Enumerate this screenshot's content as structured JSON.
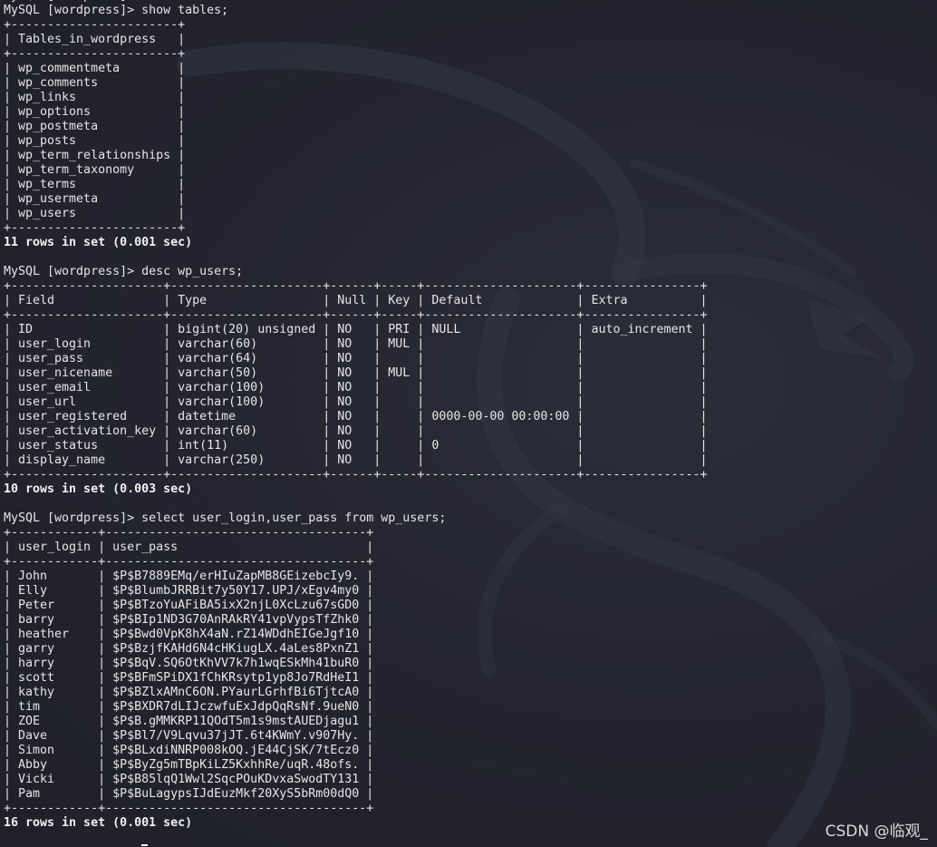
{
  "terminal": {
    "lines": [
      {
        "text": "MySQL [wordpress]>",
        "bold": false
      },
      {
        "text": "MySQL [wordpress]> show tables;",
        "bold": false
      },
      {
        "text": "+-----------------------+",
        "bold": false
      },
      {
        "text": "| Tables_in_wordpress   |",
        "bold": false
      },
      {
        "text": "+-----------------------+",
        "bold": false
      },
      {
        "text": "| wp_commentmeta        |",
        "bold": false
      },
      {
        "text": "| wp_comments           |",
        "bold": false
      },
      {
        "text": "| wp_links              |",
        "bold": false
      },
      {
        "text": "| wp_options            |",
        "bold": false
      },
      {
        "text": "| wp_postmeta           |",
        "bold": false
      },
      {
        "text": "| wp_posts              |",
        "bold": false
      },
      {
        "text": "| wp_term_relationships |",
        "bold": false
      },
      {
        "text": "| wp_term_taxonomy      |",
        "bold": false
      },
      {
        "text": "| wp_terms              |",
        "bold": false
      },
      {
        "text": "| wp_usermeta           |",
        "bold": false
      },
      {
        "text": "| wp_users              |",
        "bold": false
      },
      {
        "text": "+-----------------------+",
        "bold": false
      },
      {
        "text": "11 rows in set (0.001 sec)",
        "bold": true
      },
      {
        "text": "",
        "bold": false
      },
      {
        "text": "MySQL [wordpress]> desc wp_users;",
        "bold": false
      },
      {
        "text": "+---------------------+---------------------+------+-----+---------------------+----------------+",
        "bold": false
      },
      {
        "text": "| Field               | Type                | Null | Key | Default             | Extra          |",
        "bold": false
      },
      {
        "text": "+---------------------+---------------------+------+-----+---------------------+----------------+",
        "bold": false
      },
      {
        "text": "| ID                  | bigint(20) unsigned | NO   | PRI | NULL                | auto_increment |",
        "bold": false
      },
      {
        "text": "| user_login          | varchar(60)         | NO   | MUL |                     |                |",
        "bold": false
      },
      {
        "text": "| user_pass           | varchar(64)         | NO   |     |                     |                |",
        "bold": false
      },
      {
        "text": "| user_nicename       | varchar(50)         | NO   | MUL |                     |                |",
        "bold": false
      },
      {
        "text": "| user_email          | varchar(100)        | NO   |     |                     |                |",
        "bold": false
      },
      {
        "text": "| user_url            | varchar(100)        | NO   |     |                     |                |",
        "bold": false
      },
      {
        "text": "| user_registered     | datetime            | NO   |     | 0000-00-00 00:00:00 |                |",
        "bold": false
      },
      {
        "text": "| user_activation_key | varchar(60)         | NO   |     |                     |                |",
        "bold": false
      },
      {
        "text": "| user_status         | int(11)             | NO   |     | 0                   |                |",
        "bold": false
      },
      {
        "text": "| display_name        | varchar(250)        | NO   |     |                     |                |",
        "bold": false
      },
      {
        "text": "+---------------------+---------------------+------+-----+---------------------+----------------+",
        "bold": false
      },
      {
        "text": "10 rows in set (0.003 sec)",
        "bold": true
      },
      {
        "text": "",
        "bold": false
      },
      {
        "text": "MySQL [wordpress]> select user_login,user_pass from wp_users;",
        "bold": false
      },
      {
        "text": "+------------+------------------------------------+",
        "bold": false
      },
      {
        "text": "| user_login | user_pass                          |",
        "bold": false
      },
      {
        "text": "+------------+------------------------------------+",
        "bold": false
      },
      {
        "text": "| John       | $P$B7889EMq/erHIuZapMB8GEizebcIy9. |",
        "bold": false
      },
      {
        "text": "| Elly       | $P$BlumbJRRBit7y50Y17.UPJ/xEgv4my0 |",
        "bold": false
      },
      {
        "text": "| Peter      | $P$BTzoYuAFiBA5ixX2njL0XcLzu67sGD0 |",
        "bold": false
      },
      {
        "text": "| barry      | $P$BIp1ND3G70AnRAkRY41vpVypsTfZhk0 |",
        "bold": false
      },
      {
        "text": "| heather    | $P$Bwd0VpK8hX4aN.rZ14WDdhEIGeJgf10 |",
        "bold": false
      },
      {
        "text": "| garry      | $P$BzjfKAHd6N4cHKiugLX.4aLes8PxnZ1 |",
        "bold": false
      },
      {
        "text": "| harry      | $P$BqV.SQ6OtKhVV7k7h1wqESkMh41buR0 |",
        "bold": false
      },
      {
        "text": "| scott      | $P$BFmSPiDX1fChKRsytp1yp8Jo7RdHeI1 |",
        "bold": false
      },
      {
        "text": "| kathy      | $P$BZlxAMnC6ON.PYaurLGrhfBi6TjtcA0 |",
        "bold": false
      },
      {
        "text": "| tim        | $P$BXDR7dLIJczwfuExJdpQqRsNf.9ueN0 |",
        "bold": false
      },
      {
        "text": "| ZOE        | $P$B.gMMKRP11QOdT5m1s9mstAUEDjagu1 |",
        "bold": false
      },
      {
        "text": "| Dave       | $P$Bl7/V9Lqvu37jJT.6t4KWmY.v907Hy. |",
        "bold": false
      },
      {
        "text": "| Simon      | $P$BLxdiNNRP008kOQ.jE44CjSK/7tEcz0 |",
        "bold": false
      },
      {
        "text": "| Abby       | $P$ByZg5mTBpKiLZ5KxhhRe/uqR.48ofs. |",
        "bold": false
      },
      {
        "text": "| Vicki      | $P$B85lqQ1Wwl2SqcPOuKDvxaSwodTY131 |",
        "bold": false
      },
      {
        "text": "| Pam        | $P$BuLagypsIJdEuzMkf20XyS5bRm00dQ0 |",
        "bold": false
      },
      {
        "text": "+------------+------------------------------------+",
        "bold": false
      },
      {
        "text": "16 rows in set (0.001 sec)",
        "bold": true
      }
    ]
  },
  "watermark": {
    "text": "CSDN @临观_"
  },
  "colors": {
    "background": "#23242f",
    "text": "#e6e6e6",
    "dragon": "#3a3c4a"
  },
  "icons": {
    "backdrop": "kali-dragon-icon"
  }
}
